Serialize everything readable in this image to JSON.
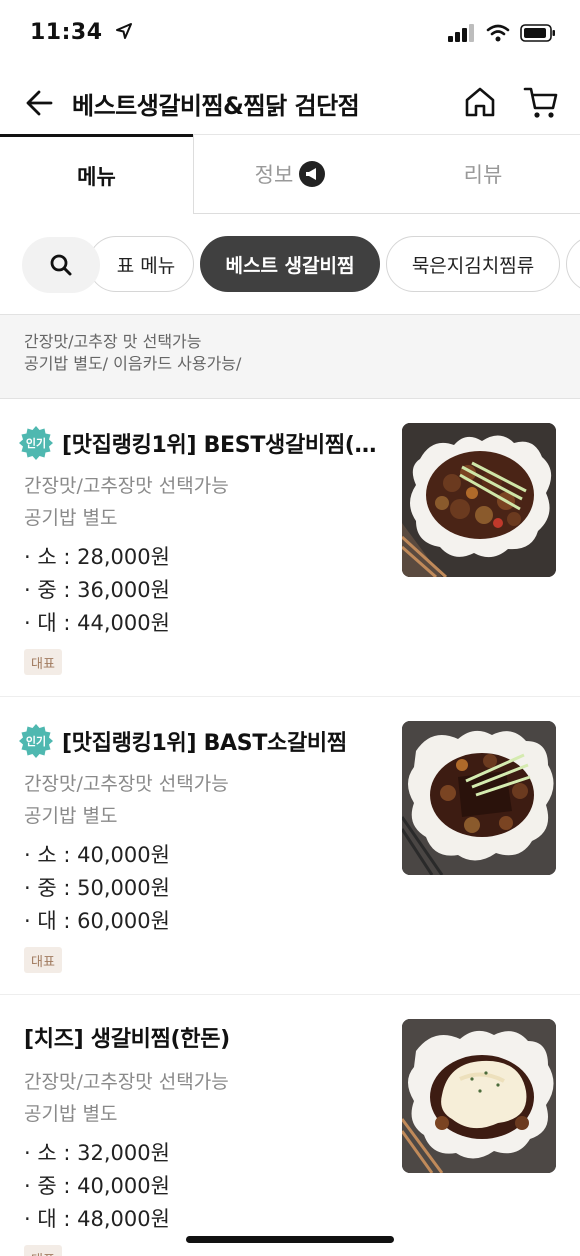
{
  "status_bar": {
    "time": "11:34"
  },
  "header": {
    "title": "베스트생갈비찜&찜닭 검단점"
  },
  "tabs": [
    {
      "label": "메뉴"
    },
    {
      "label": "정보"
    },
    {
      "label": "리뷰"
    }
  ],
  "chips": [
    {
      "label": "표 메뉴"
    },
    {
      "label": "베스트 생갈비찜"
    },
    {
      "label": "묵은지김치찜류"
    }
  ],
  "notice": {
    "line1": "간장맛/고추장 맛  선택가능",
    "line2": "공기밥 별도/ 이음카드 사용가능/"
  },
  "items": [
    {
      "badge": "인기",
      "name": "[맛집랭킹1위] BEST생갈비찜(…",
      "desc1": "간장맛/고추장맛  선택가능",
      "desc2": "공기밥 별도",
      "price1": "· 소 : 28,000원",
      "price2": "· 중 : 36,000원",
      "price3": "· 대 : 44,000원",
      "tag": "대표"
    },
    {
      "badge": "인기",
      "name": "[맛집랭킹1위] BAST소갈비찜",
      "desc1": "간장맛/고추장맛  선택가능",
      "desc2": "공기밥 별도",
      "price1": "· 소 : 40,000원",
      "price2": "· 중 : 50,000원",
      "price3": "· 대 : 60,000원",
      "tag": "대표"
    },
    {
      "name": "[치즈] 생갈비찜(한돈)",
      "desc1": "간장맛/고추장맛  선택가능",
      "desc2": "공기밥 별도",
      "price1": "· 소 : 32,000원",
      "price2": "· 중 : 40,000원",
      "price3": "· 대 : 48,000원",
      "tag": "대표"
    }
  ],
  "colors": {
    "popular_badge": "#4fb8b0",
    "active_chip": "#404040",
    "rep_tag_bg": "#f3ece6",
    "rep_tag_text": "#a07a5e"
  },
  "icons": [
    "location-arrow-icon",
    "signal-icon",
    "wifi-icon",
    "battery-icon",
    "back-arrow-icon",
    "home-icon",
    "cart-icon",
    "megaphone-icon",
    "search-icon"
  ]
}
